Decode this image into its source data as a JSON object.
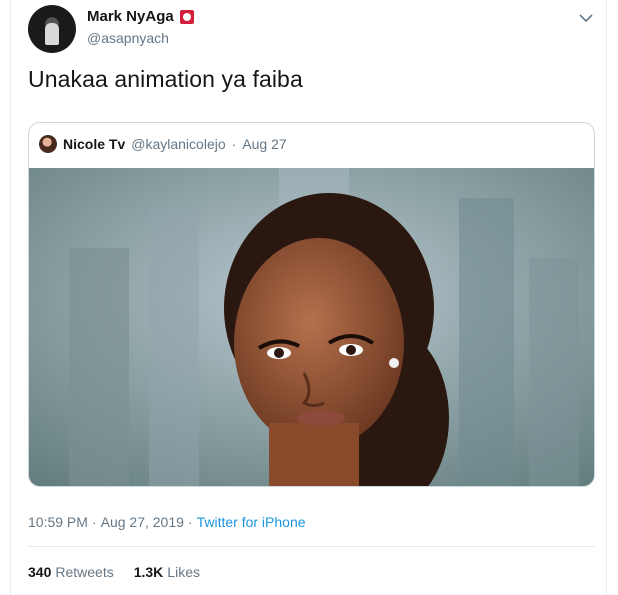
{
  "author": {
    "display_name": "Mark NyAga",
    "handle": "@asapnyach"
  },
  "tweet": {
    "text": "Unakaa animation ya faiba",
    "time": "10:59 PM",
    "separator": "·",
    "date": "Aug 27, 2019",
    "source": "Twitter for iPhone"
  },
  "quoted": {
    "display_name": "Nicole Tv",
    "handle": "@kaylanicolejo",
    "separator": "·",
    "date": "Aug 27"
  },
  "stats": {
    "retweets_count": "340",
    "retweets_label": "Retweets",
    "likes_count": "1.3K",
    "likes_label": "Likes"
  },
  "icons": [
    "badge-icon",
    "chevron-down-icon"
  ],
  "colors": {
    "link": "#1b95e0",
    "badge": "#d21f3c",
    "muted": "#657786"
  }
}
